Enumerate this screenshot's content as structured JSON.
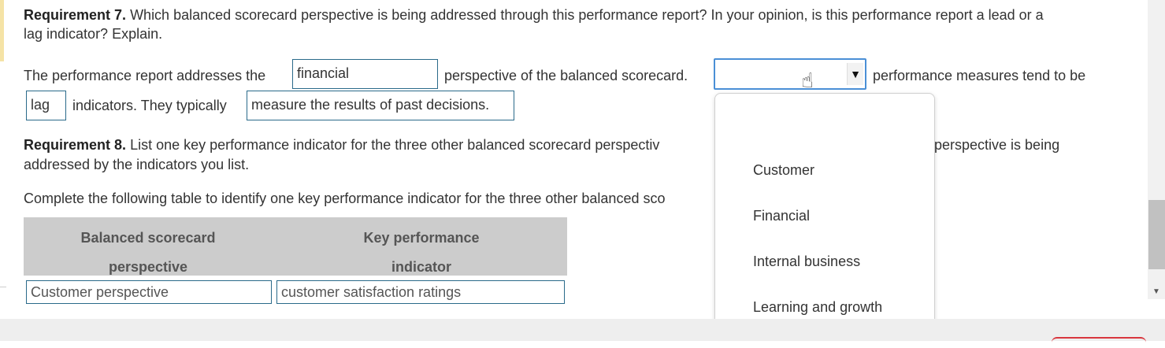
{
  "req7": {
    "label": "Requirement 7.",
    "text_line1": "Which balanced scorecard perspective is being addressed through this performance report? In your opinion, is this performance report a lead or a",
    "text_line2": "lag indicator? Explain."
  },
  "answer7": {
    "prefix": "The performance report addresses the",
    "perspective_value": "financial",
    "middle": "perspective of the balanced scorecard.",
    "select_value": "",
    "suffix": "performance measures tend to be",
    "indicator_value": "lag",
    "after_indicator": "indicators. They typically",
    "reason_value": "measure the results of past decisions."
  },
  "req8": {
    "label": "Requirement 8.",
    "text_line1_left": "List one key performance indicator for the three other balanced scorecard perspectiv",
    "text_line1_right": "perspective is being",
    "text_line2": "addressed by the indicators you list."
  },
  "instruction": "Complete the following table to identify one key performance indicator for the three other balanced sco",
  "table": {
    "headers": [
      [
        "Balanced scorecard",
        "perspective"
      ],
      [
        "Key performance",
        "indicator"
      ]
    ],
    "rows": [
      {
        "perspective": "Customer perspective",
        "indicator": "customer satisfaction ratings"
      }
    ]
  },
  "dropdown": {
    "options": [
      "",
      "Customer",
      "Financial",
      "Internal business",
      "Learning and growth"
    ]
  },
  "icons": {
    "select_arrow": "▼",
    "cursor": "hand-pointer-icon",
    "scroll_down": "▼"
  }
}
